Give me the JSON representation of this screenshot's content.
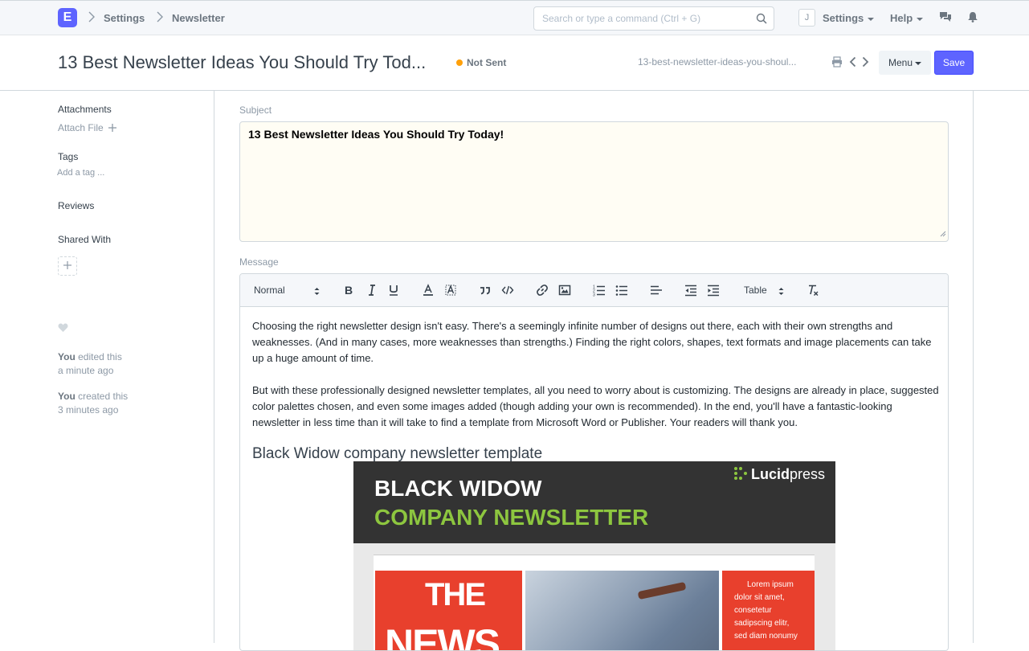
{
  "navbar": {
    "logo_letter": "E",
    "breadcrumbs": [
      "Settings",
      "Newsletter"
    ],
    "search_placeholder": "Search or type a command (Ctrl + G)",
    "avatar_letter": "J",
    "settings_label": "Settings",
    "help_label": "Help"
  },
  "page_head": {
    "title": "13 Best Newsletter Ideas You Should Try Tod...",
    "status": "Not Sent",
    "status_color": "#ffa00a",
    "doc_name": "13-best-newsletter-ideas-you-shoul...",
    "menu_label": "Menu",
    "save_label": "Save"
  },
  "sidebar": {
    "attachments_label": "Attachments",
    "attach_file_label": "Attach File",
    "tags_label": "Tags",
    "add_tag_label": "Add a tag ...",
    "reviews_label": "Reviews",
    "shared_with_label": "Shared With",
    "timeline": [
      {
        "who": "You",
        "action": "edited this",
        "when": "a minute ago"
      },
      {
        "who": "You",
        "action": "created this",
        "when": "3 minutes ago"
      }
    ]
  },
  "form": {
    "subject_label": "Subject",
    "subject_value": "13 Best Newsletter Ideas You Should Try Today!",
    "message_label": "Message",
    "toolbar": {
      "format_select": "Normal",
      "table_select": "Table"
    },
    "content": {
      "paragraph1": "Choosing the right newsletter design isn't easy. There's a seemingly infinite number of designs out there, each with their own strengths and weaknesses. (And in many cases, more weaknesses than strengths.) Finding the right colors, shapes, text formats and image placements can take up a huge amount of time.",
      "paragraph2": "But with these professionally designed newsletter templates, all you need to worry about is customizing. The designs are already in place, suggested color palettes chosen, and even some images added (though adding your own is recommended). In the end, you'll have a fantastic-looking newsletter in less time than it will take to find a template from Microsoft Word or Publisher. Your readers will thank you.",
      "heading": "Black Widow company newsletter template",
      "image": {
        "line1": "BLACK WIDOW",
        "line2": "COMPANY NEWSLETTER",
        "brand_bold": "Lucid",
        "brand_light": "press",
        "poster_word1": "THE",
        "poster_word2": "NEWS",
        "side_text": [
          "Lorem ipsum",
          "dolor sit amet,",
          "consetetur",
          "sadipscing elitr,",
          "sed diam nonumy"
        ]
      }
    }
  },
  "colors": {
    "accent": "#5e64ff",
    "green": "#8dc63f",
    "red": "#e8402d"
  }
}
